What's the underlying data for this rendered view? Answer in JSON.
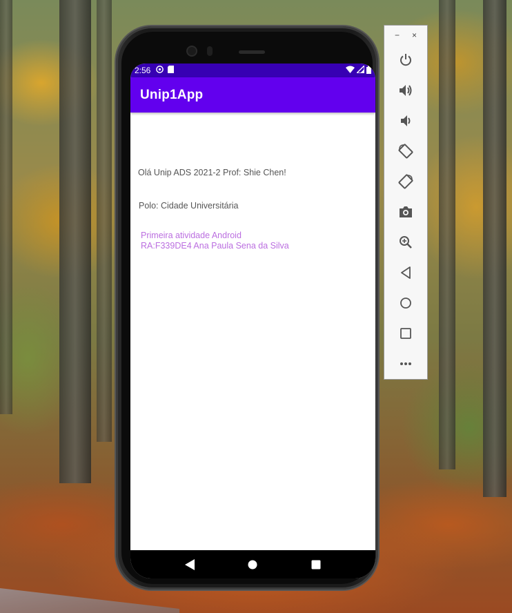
{
  "emulator_toolbar": {
    "minimize_label": "−",
    "close_label": "×",
    "buttons": [
      {
        "name": "power-icon"
      },
      {
        "name": "volume-up-icon"
      },
      {
        "name": "volume-down-icon"
      },
      {
        "name": "rotate-left-icon"
      },
      {
        "name": "rotate-right-icon"
      },
      {
        "name": "camera-icon"
      },
      {
        "name": "zoom-icon"
      },
      {
        "name": "back-icon"
      },
      {
        "name": "home-icon"
      },
      {
        "name": "overview-icon"
      },
      {
        "name": "more-icon"
      }
    ]
  },
  "status_bar": {
    "time": "2:56",
    "icons": [
      "dnd-icon",
      "sd-card-icon",
      "wifi-icon",
      "signal-icon",
      "battery-icon"
    ]
  },
  "app_bar": {
    "title": "Unip1App"
  },
  "content": {
    "line1": "Olá Unip ADS 2021-2 Prof: Shie Chen!",
    "line2": "Polo: Cidade Universitária",
    "line3a": "Primeira atividade Android",
    "line3b": "RA:F339DE4 Ana Paula Sena da Silva"
  },
  "colors": {
    "status_bar": "#3700b3",
    "app_bar": "#6200ee",
    "accent_text": "#bb6ee0",
    "body_text": "#555555"
  }
}
